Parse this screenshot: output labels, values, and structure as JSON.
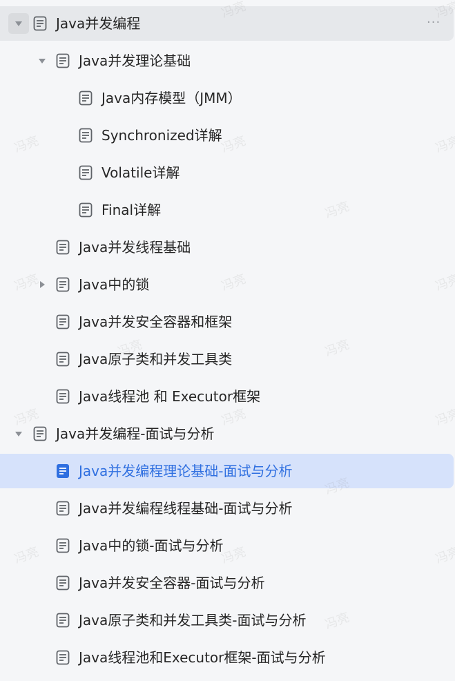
{
  "watermark": "冯亮",
  "more_glyph": "···",
  "tree": [
    {
      "id": "r0",
      "label": "Java并发编程",
      "level": 0,
      "toggle": "expanded",
      "state": "hover"
    },
    {
      "id": "r1",
      "label": "Java并发理论基础",
      "level": 1,
      "toggle": "expanded",
      "state": "normal"
    },
    {
      "id": "r2",
      "label": "Java内存模型（JMM）",
      "level": 2,
      "toggle": "none",
      "state": "normal"
    },
    {
      "id": "r3",
      "label": "Synchronized详解",
      "level": 2,
      "toggle": "none",
      "state": "normal"
    },
    {
      "id": "r4",
      "label": "Volatile详解",
      "level": 2,
      "toggle": "none",
      "state": "normal"
    },
    {
      "id": "r5",
      "label": "Final详解",
      "level": 2,
      "toggle": "none",
      "state": "normal"
    },
    {
      "id": "r6",
      "label": "Java并发线程基础",
      "level": 1,
      "toggle": "none",
      "state": "normal"
    },
    {
      "id": "r7",
      "label": "Java中的锁",
      "level": 1,
      "toggle": "collapsed",
      "state": "normal"
    },
    {
      "id": "r8",
      "label": "Java并发安全容器和框架",
      "level": 1,
      "toggle": "none",
      "state": "normal"
    },
    {
      "id": "r9",
      "label": "Java原子类和并发工具类",
      "level": 1,
      "toggle": "none",
      "state": "normal"
    },
    {
      "id": "r10",
      "label": "Java线程池 和 Executor框架",
      "level": 1,
      "toggle": "none",
      "state": "normal"
    },
    {
      "id": "r11",
      "label": "Java并发编程-面试与分析",
      "level": 0,
      "toggle": "expanded",
      "state": "normal"
    },
    {
      "id": "r12",
      "label": "Java并发编程理论基础-面试与分析",
      "level": 1,
      "toggle": "none",
      "state": "active"
    },
    {
      "id": "r13",
      "label": "Java并发编程线程基础-面试与分析",
      "level": 1,
      "toggle": "none",
      "state": "normal"
    },
    {
      "id": "r14",
      "label": "Java中的锁-面试与分析",
      "level": 1,
      "toggle": "none",
      "state": "normal"
    },
    {
      "id": "r15",
      "label": "Java并发安全容器-面试与分析",
      "level": 1,
      "toggle": "none",
      "state": "normal"
    },
    {
      "id": "r16",
      "label": "Java原子类和并发工具类-面试与分析",
      "level": 1,
      "toggle": "none",
      "state": "normal"
    },
    {
      "id": "r17",
      "label": "Java线程池和Executor框架-面试与分析",
      "level": 1,
      "toggle": "none",
      "state": "normal"
    }
  ],
  "colors": {
    "background": "#f5f6f8",
    "hover": "#e6e8eb",
    "active_bg": "#d6e2fb",
    "active_text": "#2f6fe0",
    "text": "#262626",
    "icon": "#5f6368"
  }
}
